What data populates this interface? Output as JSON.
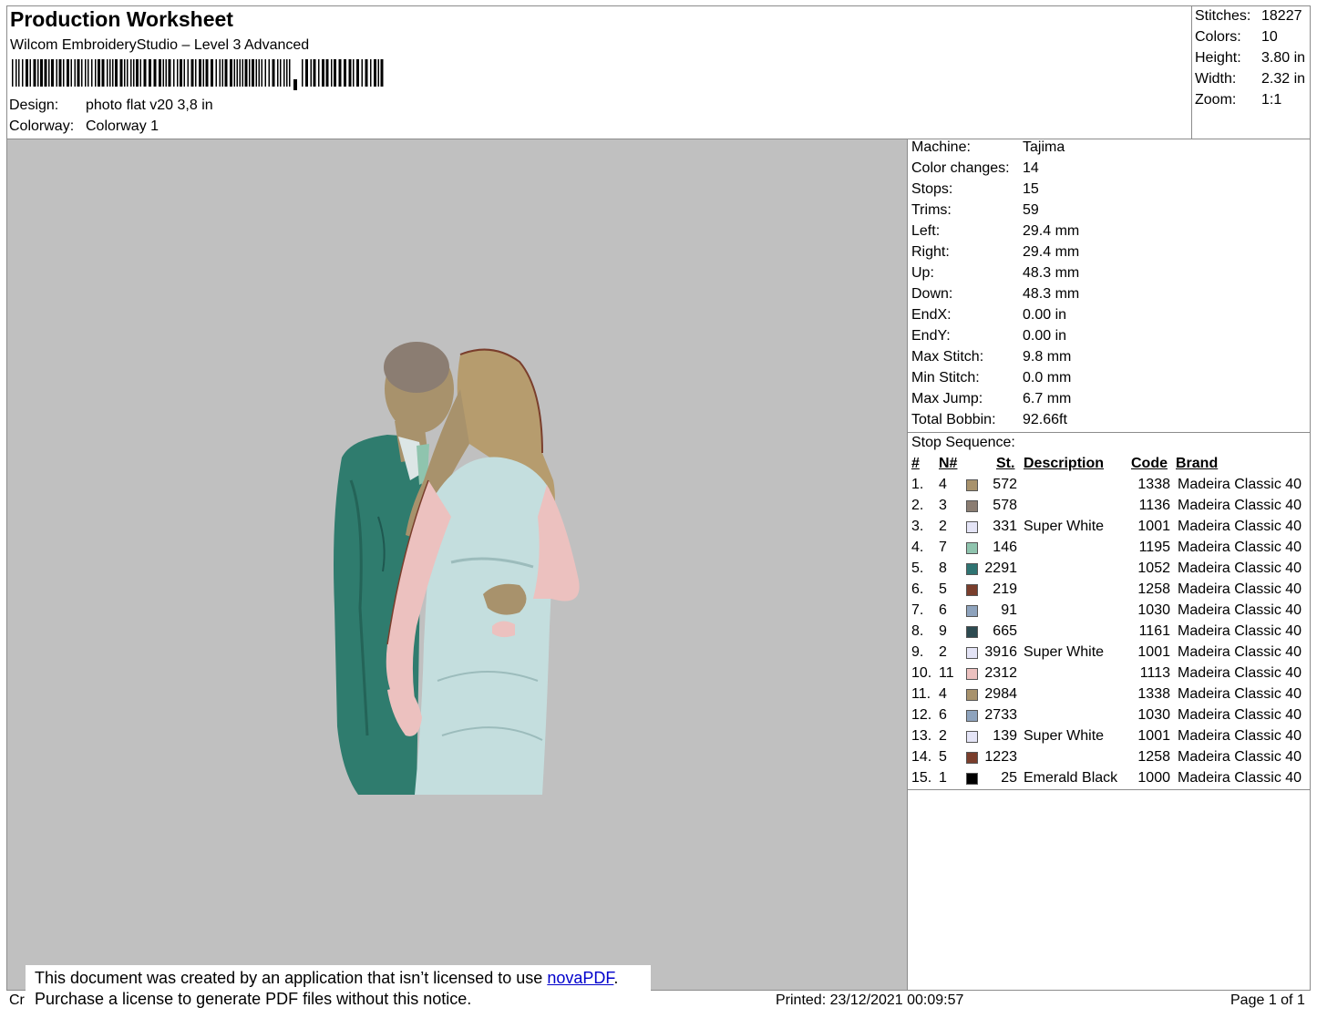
{
  "header": {
    "title": "Production Worksheet",
    "subtitle": "Wilcom EmbroideryStudio – Level 3 Advanced",
    "design_label": "Design:",
    "design_value": "photo flat v20 3,8 in",
    "colorway_label": "Colorway:",
    "colorway_value": "Colorway 1"
  },
  "stats": [
    {
      "label": "Stitches:",
      "value": "18227"
    },
    {
      "label": "Colors:",
      "value": "10"
    },
    {
      "label": "Height:",
      "value": "3.80 in"
    },
    {
      "label": "Width:",
      "value": "2.32 in"
    },
    {
      "label": "Zoom:",
      "value": "1:1"
    }
  ],
  "details": [
    {
      "label": "Machine:",
      "value": "Tajima"
    },
    {
      "label": "Color changes:",
      "value": "14"
    },
    {
      "label": "Stops:",
      "value": "15"
    },
    {
      "label": "Trims:",
      "value": "59"
    },
    {
      "label": "Left:",
      "value": "29.4 mm"
    },
    {
      "label": "Right:",
      "value": "29.4 mm"
    },
    {
      "label": "Up:",
      "value": "48.3 mm"
    },
    {
      "label": "Down:",
      "value": "48.3 mm"
    },
    {
      "label": "EndX:",
      "value": "0.00 in"
    },
    {
      "label": "EndY:",
      "value": "0.00 in"
    },
    {
      "label": "Max Stitch:",
      "value": "9.8 mm"
    },
    {
      "label": "Min Stitch:",
      "value": "0.0 mm"
    },
    {
      "label": "Max Jump:",
      "value": "6.7 mm"
    },
    {
      "label": "Total Bobbin:",
      "value": "92.66ft"
    }
  ],
  "stop_sequence": {
    "title": "Stop Sequence:",
    "headers": {
      "num": "#",
      "n": "N#",
      "st": "St.",
      "desc": "Description",
      "code": "Code",
      "brand": "Brand"
    },
    "rows": [
      {
        "num": "1.",
        "n": "4",
        "color": "#a8926c",
        "st": "572",
        "desc": "",
        "code": "1338",
        "brand": "Madeira Classic 40"
      },
      {
        "num": "2.",
        "n": "3",
        "color": "#8b7d72",
        "st": "578",
        "desc": "",
        "code": "1136",
        "brand": "Madeira Classic 40"
      },
      {
        "num": "3.",
        "n": "2",
        "color": "#e4e4f6",
        "st": "331",
        "desc": "Super White",
        "code": "1001",
        "brand": "Madeira Classic 40"
      },
      {
        "num": "4.",
        "n": "7",
        "color": "#8fc4ae",
        "st": "146",
        "desc": "",
        "code": "1195",
        "brand": "Madeira Classic 40"
      },
      {
        "num": "5.",
        "n": "8",
        "color": "#2f7472",
        "st": "2291",
        "desc": "",
        "code": "1052",
        "brand": "Madeira Classic 40"
      },
      {
        "num": "6.",
        "n": "5",
        "color": "#7a3e2c",
        "st": "219",
        "desc": "",
        "code": "1258",
        "brand": "Madeira Classic 40"
      },
      {
        "num": "7.",
        "n": "6",
        "color": "#8ea3bd",
        "st": "91",
        "desc": "",
        "code": "1030",
        "brand": "Madeira Classic 40"
      },
      {
        "num": "8.",
        "n": "9",
        "color": "#2c4a50",
        "st": "665",
        "desc": "",
        "code": "1161",
        "brand": "Madeira Classic 40"
      },
      {
        "num": "9.",
        "n": "2",
        "color": "#e4e4f6",
        "st": "3916",
        "desc": "Super White",
        "code": "1001",
        "brand": "Madeira Classic 40"
      },
      {
        "num": "10.",
        "n": "11",
        "color": "#ecc1bf",
        "st": "2312",
        "desc": "",
        "code": "1113",
        "brand": "Madeira Classic 40"
      },
      {
        "num": "11.",
        "n": "4",
        "color": "#a8926c",
        "st": "2984",
        "desc": "",
        "code": "1338",
        "brand": "Madeira Classic 40"
      },
      {
        "num": "12.",
        "n": "6",
        "color": "#8ea3bd",
        "st": "2733",
        "desc": "",
        "code": "1030",
        "brand": "Madeira Classic 40"
      },
      {
        "num": "13.",
        "n": "2",
        "color": "#e4e4f6",
        "st": "139",
        "desc": "Super White",
        "code": "1001",
        "brand": "Madeira Classic 40"
      },
      {
        "num": "14.",
        "n": "5",
        "color": "#7a3e2c",
        "st": "1223",
        "desc": "",
        "code": "1258",
        "brand": "Madeira Classic 40"
      },
      {
        "num": "15.",
        "n": "1",
        "color": "#000000",
        "st": "25",
        "desc": "Emerald Black",
        "code": "1000",
        "brand": "Madeira Classic 40"
      }
    ]
  },
  "footer": {
    "created_partial": "Cr",
    "notice_line1_prefix": "This document was created by an application that isn’t licensed to use ",
    "notice_link": "novaPDF",
    "notice_line1_suffix": ".",
    "notice_line2": "Purchase a license to generate PDF files without this notice.",
    "printed": "Printed: 23/12/2021 00:09:57",
    "page": "Page 1 of 1"
  },
  "colors": {
    "preview_bg": "#c0c0c0",
    "border": "#8c8c8c",
    "link": "#0000cc"
  }
}
